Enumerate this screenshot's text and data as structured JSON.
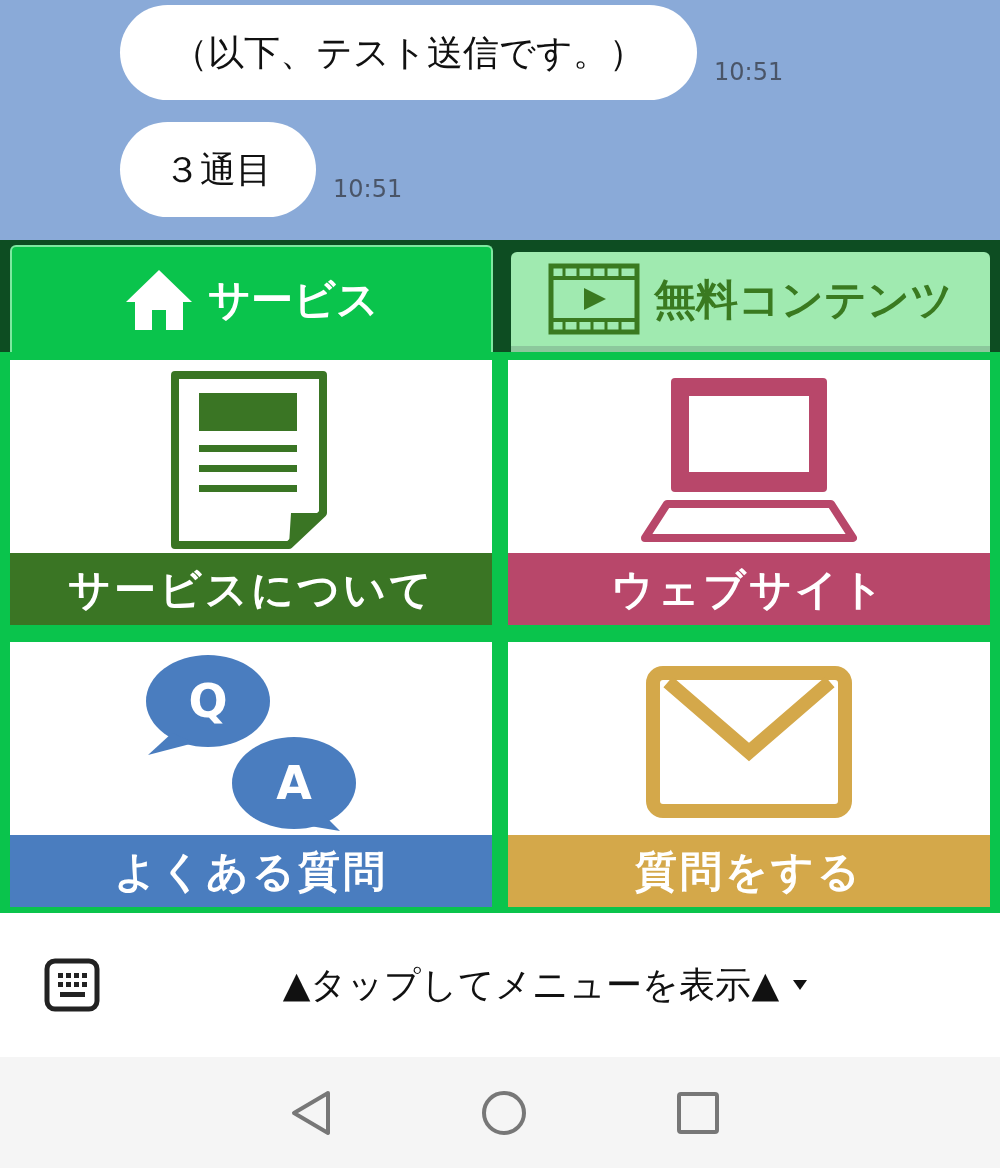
{
  "messages": [
    {
      "text": "（以下、テスト送信です。）",
      "time": "10:51"
    },
    {
      "text": "３通目",
      "time": "10:51"
    }
  ],
  "tabs": [
    {
      "label": "サービス",
      "kind": "home",
      "selected": true
    },
    {
      "label": "無料コンテンツ",
      "kind": "film",
      "selected": false
    }
  ],
  "menu_items": [
    {
      "label": "サービスについて",
      "kind": "document",
      "color": "#3a7524"
    },
    {
      "label": "ウェブサイト",
      "kind": "laptop",
      "color": "#b8476a"
    },
    {
      "label": "よくある質問",
      "kind": "qa",
      "color": "#4a7dbf",
      "badges": [
        "Q",
        "A"
      ]
    },
    {
      "label": "質問をする",
      "kind": "mail",
      "color": "#d4a84a"
    }
  ],
  "menu_bar": {
    "label": "▲タップしてメニューを表示▲"
  }
}
